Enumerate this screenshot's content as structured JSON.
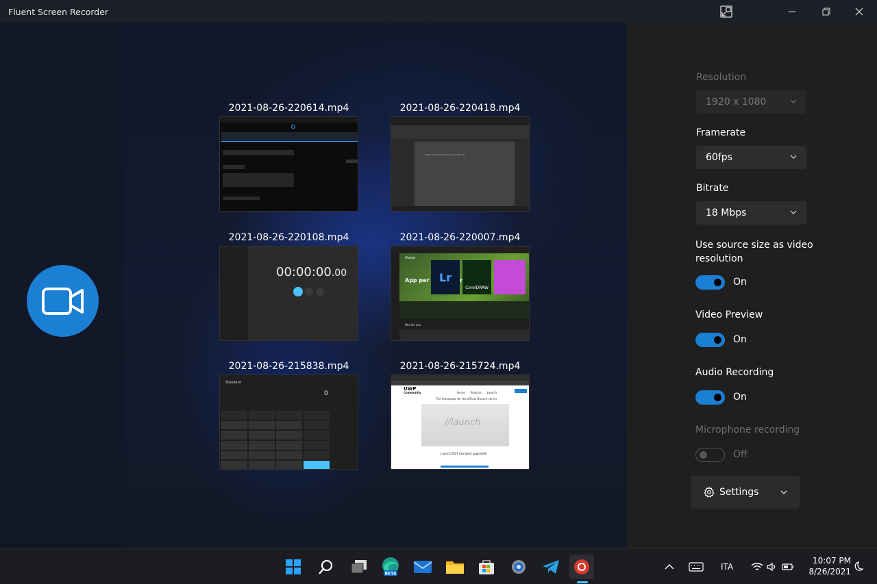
{
  "window": {
    "title": "Fluent Screen Recorder"
  },
  "recordings": [
    {
      "name": "2021-08-26-220614.mp4"
    },
    {
      "name": "2021-08-26-220418.mp4"
    },
    {
      "name": "2021-08-26-220108.mp4"
    },
    {
      "name": "2021-08-26-220007.mp4"
    },
    {
      "name": "2021-08-26-215838.mp4"
    },
    {
      "name": "2021-08-26-215724.mp4"
    }
  ],
  "thumbs": {
    "clock_time": "00:00:00",
    "clock_ms": ".00",
    "calc_mode": "Standard",
    "calc_display": "0",
    "store_banner": "App per professionisti",
    "store_app1": "Lr",
    "store_app2": "CorelDRAW",
    "store_section": "Home",
    "store_picks": "Hits for you",
    "uwp_brand": "UWP",
    "uwp_brand2": "Community",
    "uwp_tagline": "The homepage for the official Discord server",
    "uwp_launch": "//launch",
    "uwp_notice": "Launch 2021 has been upgraded!",
    "uwp_nav": [
      "Home",
      "Projects",
      "Launch"
    ],
    "word_doc_text": "Word document Recorded in a test doc"
  },
  "settings": {
    "resolution": {
      "label": "Resolution",
      "value": "1920 x 1080"
    },
    "framerate": {
      "label": "Framerate",
      "value": "60fps"
    },
    "bitrate": {
      "label": "Bitrate",
      "value": "18 Mbps"
    },
    "source_size": {
      "label": "Use source size as video resolution",
      "state": "On"
    },
    "video_preview": {
      "label": "Video Preview",
      "state": "On"
    },
    "audio_recording": {
      "label": "Audio Recording",
      "state": "On"
    },
    "microphone": {
      "label": "Microphone recording",
      "state": "Off"
    },
    "settings_button": "Settings"
  },
  "taskbar": {
    "language": "ITA",
    "time": "10:07 PM",
    "date": "8/26/2021",
    "edge_badge": "BETA"
  },
  "colors": {
    "accent": "#1b7fd3",
    "panel_bg": "#1f1f1f",
    "record_red": "#d83b2c"
  }
}
